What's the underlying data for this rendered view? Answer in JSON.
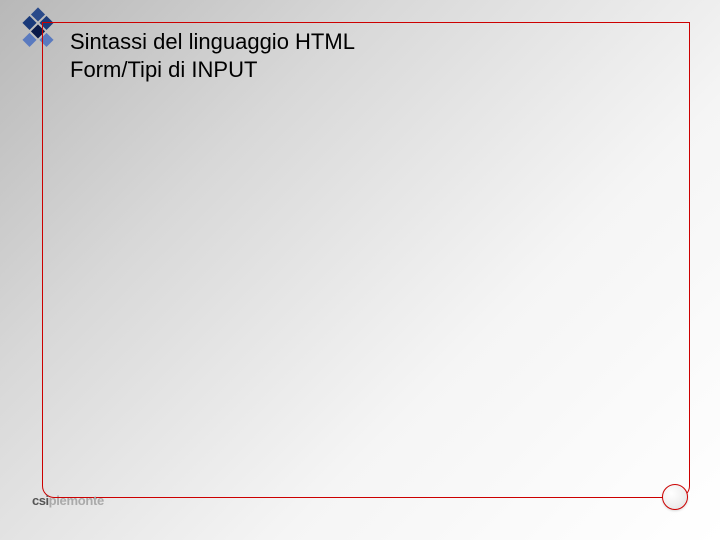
{
  "title": {
    "line1": "Sintassi del linguaggio HTML",
    "line2": "Form/Tipi di INPUT"
  },
  "footer": {
    "brand_bold": "csi",
    "brand_light": "piemonte"
  },
  "colors": {
    "accent": "#cc0000",
    "logo_blue": "#2a4a8a",
    "logo_navy": "#0a1a4a"
  }
}
